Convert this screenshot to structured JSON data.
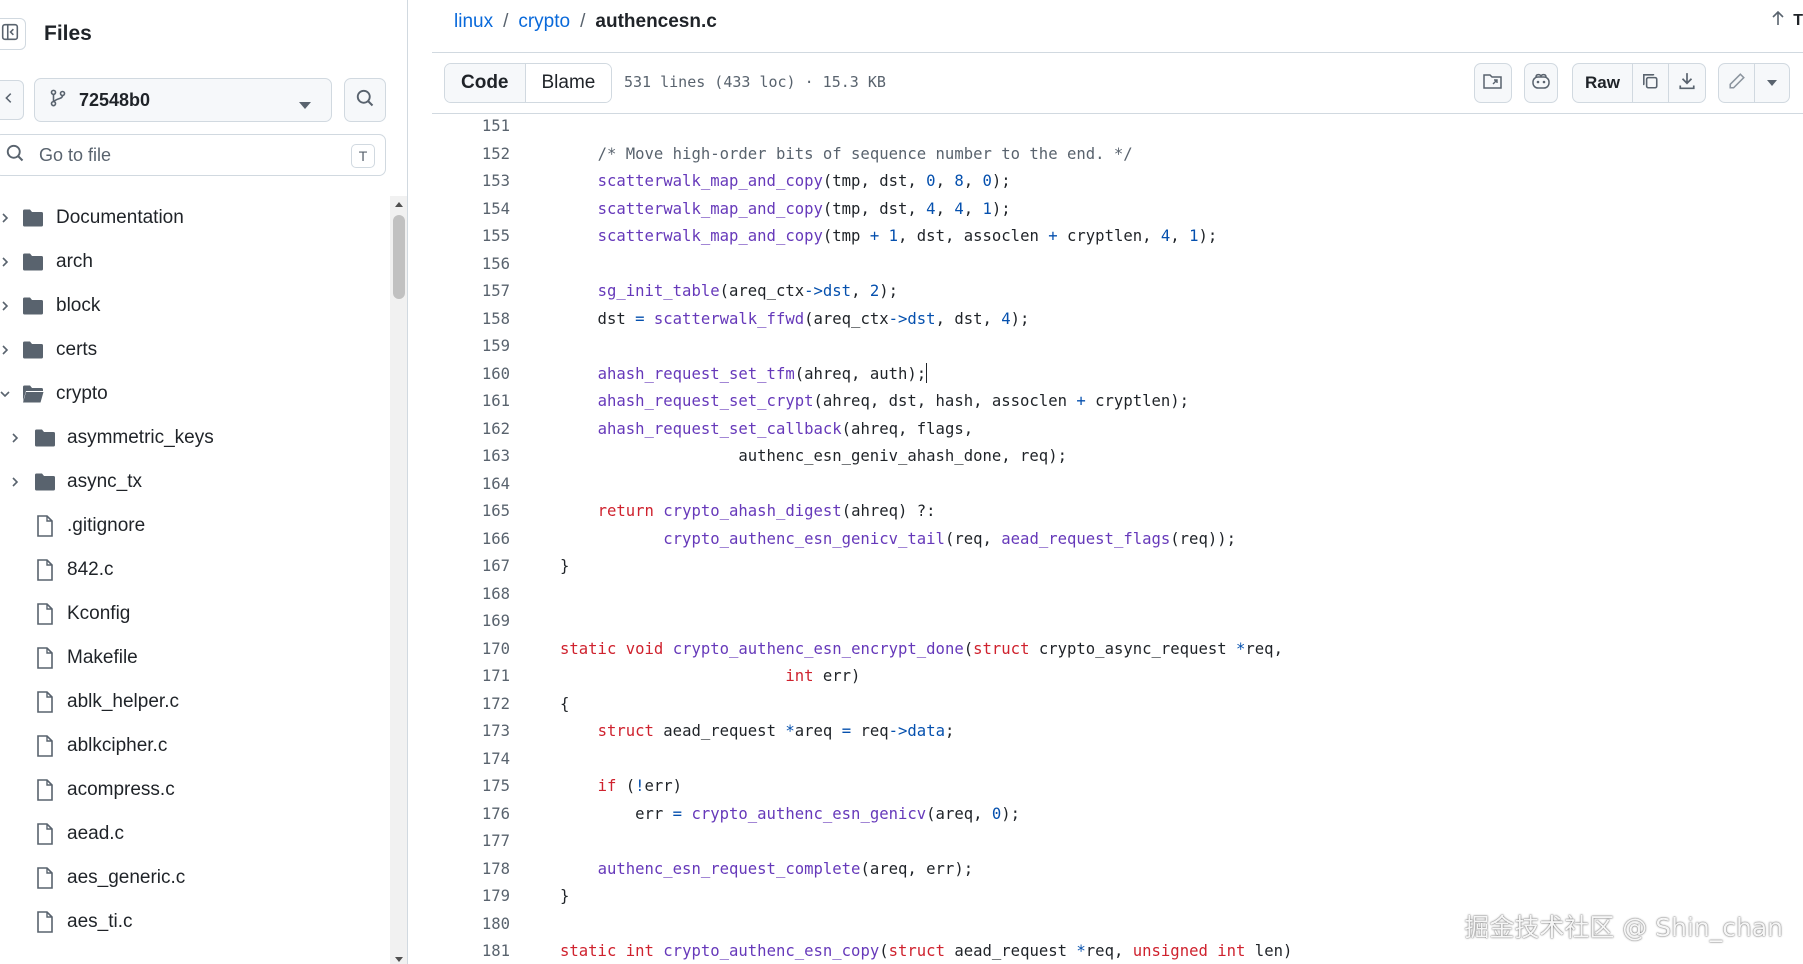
{
  "sidebar": {
    "title": "Files",
    "branch": "72548b0",
    "search_placeholder": "Go to file",
    "shortcut_key": "T",
    "items": [
      {
        "name": "Documentation",
        "type": "folder",
        "depth": 0,
        "expanded": false
      },
      {
        "name": "arch",
        "type": "folder",
        "depth": 0,
        "expanded": false
      },
      {
        "name": "block",
        "type": "folder",
        "depth": 0,
        "expanded": false
      },
      {
        "name": "certs",
        "type": "folder",
        "depth": 0,
        "expanded": false
      },
      {
        "name": "crypto",
        "type": "folder",
        "depth": 0,
        "expanded": true
      },
      {
        "name": "asymmetric_keys",
        "type": "folder",
        "depth": 1,
        "expanded": false
      },
      {
        "name": "async_tx",
        "type": "folder",
        "depth": 1,
        "expanded": false
      },
      {
        "name": ".gitignore",
        "type": "file",
        "depth": 1
      },
      {
        "name": "842.c",
        "type": "file",
        "depth": 1
      },
      {
        "name": "Kconfig",
        "type": "file",
        "depth": 1
      },
      {
        "name": "Makefile",
        "type": "file",
        "depth": 1
      },
      {
        "name": "ablk_helper.c",
        "type": "file",
        "depth": 1
      },
      {
        "name": "ablkcipher.c",
        "type": "file",
        "depth": 1
      },
      {
        "name": "acompress.c",
        "type": "file",
        "depth": 1
      },
      {
        "name": "aead.c",
        "type": "file",
        "depth": 1
      },
      {
        "name": "aes_generic.c",
        "type": "file",
        "depth": 1
      },
      {
        "name": "aes_ti.c",
        "type": "file",
        "depth": 1
      }
    ]
  },
  "breadcrumb": {
    "repo": "linux",
    "dir": "crypto",
    "file": "authencesn.c",
    "separator": "/"
  },
  "top_right_label": "T",
  "toolbar": {
    "code_tab": "Code",
    "blame_tab": "Blame",
    "file_info": "531 lines (433 loc) · 15.3 KB",
    "raw_label": "Raw"
  },
  "code_lines": [
    {
      "n": "151",
      "html": ""
    },
    {
      "n": "152",
      "html": "    <span class=\"c\">/* Move high-order bits of sequence number to the end. */</span>"
    },
    {
      "n": "153",
      "html": "    <span class=\"f\">scatterwalk_map_and_copy</span>(tmp, dst, <span class=\"n\">0</span>, <span class=\"n\">8</span>, <span class=\"n\">0</span>);"
    },
    {
      "n": "154",
      "html": "    <span class=\"f\">scatterwalk_map_and_copy</span>(tmp, dst, <span class=\"n\">4</span>, <span class=\"n\">4</span>, <span class=\"n\">1</span>);"
    },
    {
      "n": "155",
      "html": "    <span class=\"f\">scatterwalk_map_and_copy</span>(tmp <span class=\"o\">+</span> <span class=\"n\">1</span>, dst, assoclen <span class=\"o\">+</span> cryptlen, <span class=\"n\">4</span>, <span class=\"n\">1</span>);"
    },
    {
      "n": "156",
      "html": ""
    },
    {
      "n": "157",
      "html": "    <span class=\"f\">sg_init_table</span>(areq_ctx<span class=\"o\">-&gt;</span><span class=\"n\">dst</span>, <span class=\"n\">2</span>);"
    },
    {
      "n": "158",
      "html": "    dst <span class=\"o\">=</span> <span class=\"f\">scatterwalk_ffwd</span>(areq_ctx<span class=\"o\">-&gt;</span><span class=\"n\">dst</span>, dst, <span class=\"n\">4</span>);"
    },
    {
      "n": "159",
      "html": ""
    },
    {
      "n": "160",
      "html": "    <span class=\"f\">ahash_request_set_tfm</span>(ahreq, auth);<span class=\"caret-cursor\"></span>"
    },
    {
      "n": "161",
      "html": "    <span class=\"f\">ahash_request_set_crypt</span>(ahreq, dst, hash, assoclen <span class=\"o\">+</span> cryptlen);"
    },
    {
      "n": "162",
      "html": "    <span class=\"f\">ahash_request_set_callback</span>(ahreq, flags,"
    },
    {
      "n": "163",
      "html": "                   authenc_esn_geniv_ahash_done, req);"
    },
    {
      "n": "164",
      "html": ""
    },
    {
      "n": "165",
      "html": "    <span class=\"k\">return</span> <span class=\"f\">crypto_ahash_digest</span>(ahreq) ?:"
    },
    {
      "n": "166",
      "html": "           <span class=\"f\">crypto_authenc_esn_genicv_tail</span>(req, <span class=\"f\">aead_request_flags</span>(req));"
    },
    {
      "n": "167",
      "html": "}"
    },
    {
      "n": "168",
      "html": ""
    },
    {
      "n": "169",
      "html": ""
    },
    {
      "n": "170",
      "html": "<span class=\"k\">static</span> <span class=\"k\">void</span> <span class=\"f\">crypto_authenc_esn_encrypt_done</span>(<span class=\"k\">struct</span> crypto_async_request <span class=\"o\">*</span>req,"
    },
    {
      "n": "171",
      "html": "                        <span class=\"k\">int</span> err)"
    },
    {
      "n": "172",
      "html": "{"
    },
    {
      "n": "173",
      "html": "    <span class=\"k\">struct</span> aead_request <span class=\"o\">*</span>areq <span class=\"o\">=</span> req<span class=\"o\">-&gt;</span><span class=\"n\">data</span>;"
    },
    {
      "n": "174",
      "html": ""
    },
    {
      "n": "175",
      "html": "    <span class=\"k\">if</span> (<span class=\"o\">!</span>err)"
    },
    {
      "n": "176",
      "html": "        err <span class=\"o\">=</span> <span class=\"f\">crypto_authenc_esn_genicv</span>(areq, <span class=\"n\">0</span>);"
    },
    {
      "n": "177",
      "html": ""
    },
    {
      "n": "178",
      "html": "    <span class=\"f\">authenc_esn_request_complete</span>(areq, err);"
    },
    {
      "n": "179",
      "html": "}"
    },
    {
      "n": "180",
      "html": ""
    },
    {
      "n": "181",
      "html": "<span class=\"k\">static</span> <span class=\"k\">int</span> <span class=\"f\">crypto_authenc_esn_copy</span>(<span class=\"k\">struct</span> aead_request <span class=\"o\">*</span>req, <span class=\"k\">unsigned</span> <span class=\"k\">int</span> len)"
    }
  ],
  "watermark": "掘金技术社区 @ Shin_chan",
  "colors": {
    "accent": "#0969da",
    "keyword": "#cf222e",
    "function": "#6639ba",
    "comment": "#59636e",
    "number": "#0550ae",
    "border": "#d1d9e0"
  }
}
